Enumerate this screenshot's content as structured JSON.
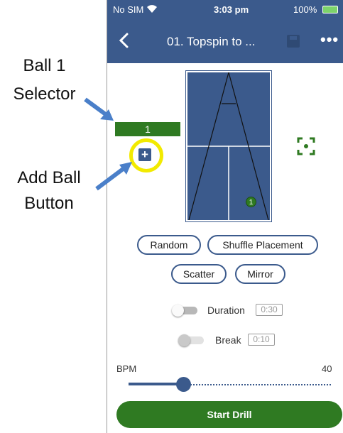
{
  "annotations": {
    "ball_selector_label_line1": "Ball 1",
    "ball_selector_label_line2": "Selector",
    "add_ball_label_line1": "Add Ball",
    "add_ball_label_line2": "Button",
    "arrow_color": "#4a7fc9",
    "highlight_color": "#f2ea00"
  },
  "status_bar": {
    "carrier": "No SIM",
    "time": "3:03 pm",
    "battery": "100%"
  },
  "app_bar": {
    "back_icon": "chevron-left-icon",
    "title": "01. Topspin to ...",
    "save_icon": "save-icon",
    "more_icon": "more-horizontal-icon",
    "more_glyph": "•••"
  },
  "drill": {
    "ball_selector_value": "1",
    "add_ball_glyph": "+",
    "ball_marker_number": "1",
    "focus_icon": "focus-target-icon"
  },
  "chips": {
    "random": "Random",
    "shuffle_placement": "Shuffle Placement",
    "scatter": "Scatter",
    "mirror": "Mirror"
  },
  "toggles": {
    "duration": {
      "label": "Duration",
      "value": "0:30",
      "on": false
    },
    "break": {
      "label": "Break",
      "value": "0:10",
      "on": false
    }
  },
  "bpm": {
    "label": "BPM",
    "value": "40",
    "slider_fraction": 0.27
  },
  "start_button": "Start Drill",
  "colors": {
    "primary_blue": "#3b5a8c",
    "green": "#2f7a22"
  }
}
